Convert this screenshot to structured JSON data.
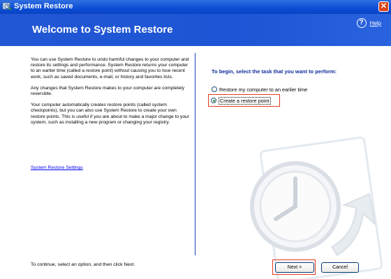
{
  "window": {
    "title": "System Restore",
    "close_symbol": "✕"
  },
  "banner": {
    "heading": "Welcome to System Restore",
    "help_label": "Help"
  },
  "left": {
    "paragraphs": [
      "You can use System Restore to undo harmful changes to your computer and restore its settings and performance. System Restore returns your computer to an earlier time (called a restore point) without causing you to lose recent work, such as saved documents, e-mail, or history and favorites lists.",
      "Any changes that System Restore makes to your computer are completely reversible.",
      "Your computer automatically creates restore points (called system checkpoints), but you can also use System Restore to create your own restore points. This is useful if you are about to make a major change to your system, such as installing a new program or changing your registry."
    ],
    "settings_link": "System Restore Settings"
  },
  "right": {
    "prompt": "To begin, select the task that you want to perform:",
    "options": [
      {
        "label": "Restore my computer to an earlier time",
        "selected": false
      },
      {
        "label": "Create a restore point",
        "selected": true
      }
    ]
  },
  "footer": {
    "instruction": "To continue, select an option, and then click Next.",
    "next_label": "Next >",
    "cancel_label": "Cancel"
  },
  "colors": {
    "accent": "#1c55d5",
    "highlight": "#e53a1c",
    "prompt": "#0d2d9c"
  }
}
